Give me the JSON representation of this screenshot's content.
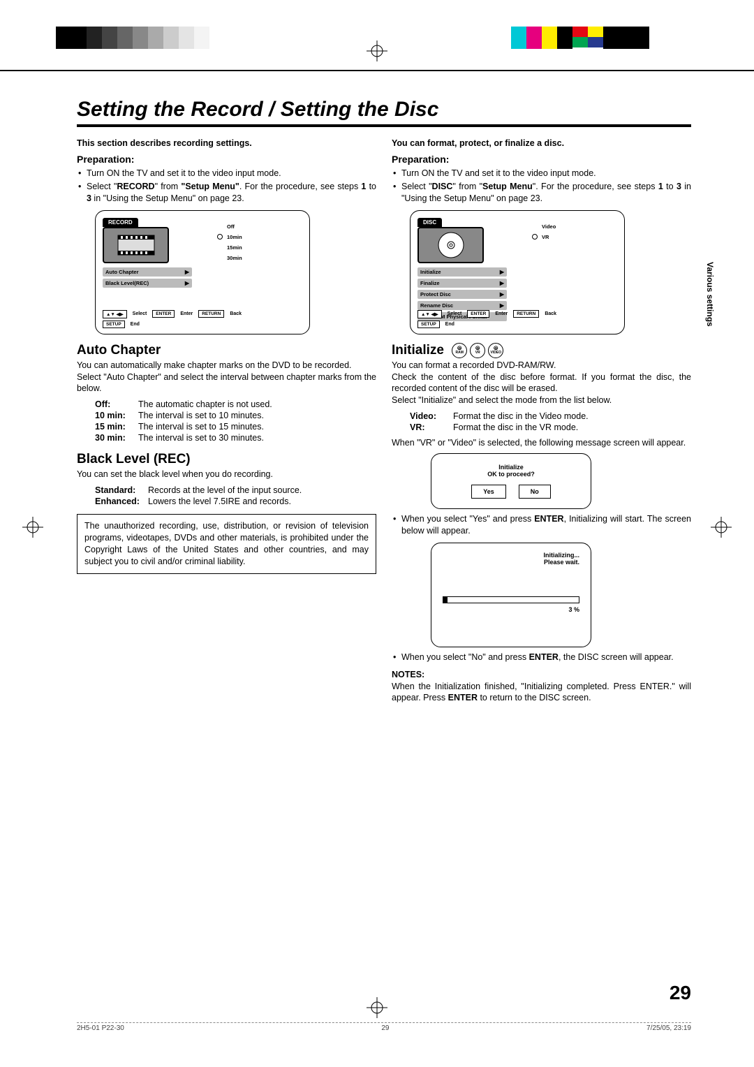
{
  "title": "Setting the Record / Setting the Disc",
  "pageNumber": "29",
  "sideTab": "Various settings",
  "footer": {
    "doc": "2H5-01 P22-30",
    "pg": "29",
    "date": "7/25/05, 23:19"
  },
  "left": {
    "intro": "This section describes recording settings.",
    "prepHeading": "Preparation:",
    "prep1": "Turn ON the TV and set it to the video input mode.",
    "prep2a": "Select \"",
    "prep2b": "RECORD",
    "prep2c": "\" from ",
    "prep2d": "\"Setup Menu\"",
    "prep2e": ". For the procedure, see steps ",
    "prep2f": "1",
    "prep2g": " to ",
    "prep2h": "3",
    "prep2i": " in \"Using the Setup Menu\" on page 23.",
    "osd": {
      "tab": "RECORD",
      "items": [
        "Auto Chapter",
        "Black Level(REC)"
      ],
      "opts": [
        "Off",
        "10min",
        "15min",
        "30min"
      ],
      "bottom": {
        "select": "Select",
        "enter": "ENTER",
        "enterLbl": "Enter",
        "return": "RETURN",
        "back": "Back",
        "setup": "SETUP",
        "end": "End"
      }
    },
    "auto": {
      "h": "Auto Chapter",
      "p1": "You can automatically make chapter marks on the DVD to be recorded.",
      "p2": "Select \"Auto Chapter\" and select the interval between chapter marks from the below.",
      "rows": [
        {
          "k": "Off",
          "v": "The automatic chapter is not used."
        },
        {
          "k": "10 min",
          "v": "The interval is set to 10 minutes."
        },
        {
          "k": "15 min",
          "v": "The interval is set to 15 minutes."
        },
        {
          "k": "30 min",
          "v": "The interval is set to 30 minutes."
        }
      ]
    },
    "black": {
      "h": "Black Level (REC)",
      "p1": "You can set the black level when you do recording.",
      "rows": [
        {
          "k": "Standard:",
          "v": "Records at the level of the input source."
        },
        {
          "k": "Enhanced:",
          "v": "Lowers the level 7.5IRE and records."
        }
      ]
    },
    "legal": "The unauthorized recording, use, distribution, or revision of television programs, videotapes, DVDs and other materials, is prohibited under the Copyright Laws of the United States and other countries, and may subject you to civil and/or criminal liability."
  },
  "right": {
    "intro": "You can format, protect, or finalize a disc.",
    "prepHeading": "Preparation:",
    "prep1": "Turn ON the TV and set it to the video input mode.",
    "prep2a": "Select \"",
    "prep2b": "DISC",
    "prep2c": "\" from \"",
    "prep2d": "Setup Menu",
    "prep2e": "\". For the procedure, see steps ",
    "prep2f": "1",
    "prep2g": " to ",
    "prep2h": "3",
    "prep2i": " in \"Using the Setup Menu\" on page 23.",
    "osd": {
      "tab": "DISC",
      "items": [
        "Initialize",
        "Finalize",
        "Protect Disc",
        "Rename Disc",
        "DVD-RAM Physical Format"
      ],
      "opts": [
        "Video",
        "VR"
      ],
      "bottom": {
        "select": "Select",
        "enter": "ENTER",
        "enterLbl": "Enter",
        "return": "RETURN",
        "back": "Back",
        "setup": "SETUP",
        "end": "End"
      }
    },
    "init": {
      "h": "Initialize",
      "badges": [
        "RAM",
        "VR",
        "VIDEO"
      ],
      "p1": "You can format a recorded DVD-RAM/RW.",
      "p2": "Check the content of the disc before format. If you format the disc, the recorded content of the disc will be erased.",
      "p3": "Select \"Initialize\" and select the mode from the list below.",
      "rows": [
        {
          "k": "Video",
          "v": "Format the disc in the Video mode."
        },
        {
          "k": "VR",
          "v": "Format the disc in the VR mode."
        }
      ],
      "p4": "When \"VR\" or \"Video\" is selected, the following message screen will appear.",
      "dialogTitle": "Initialize",
      "dialogMsg": "OK to proceed?",
      "yes": "Yes",
      "no": "No",
      "afterYes1": "When you select \"Yes\" and press ",
      "afterYes2": "ENTER",
      "afterYes3": ", Initializing will start. The screen below will appear.",
      "progress1": "Initializing...",
      "progress2": "Please  wait.",
      "progressPct": "3 %",
      "afterNo1": "When you select \"No\" and press ",
      "afterNo2": "ENTER",
      "afterNo3": ", the DISC screen will appear.",
      "notesH": "NOTES:",
      "notes1": "When the Initialization finished, \"Initializing completed. Press ENTER.\" will appear. Press ",
      "notes2": "ENTER",
      "notes3": " to return to the DISC screen."
    }
  }
}
